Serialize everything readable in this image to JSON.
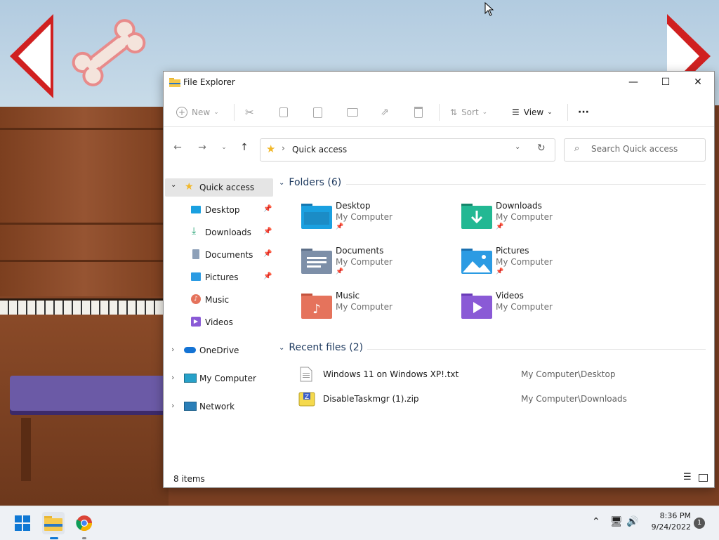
{
  "window": {
    "title": "File Explorer",
    "controls": {
      "minimize": "—",
      "maximize": "☐",
      "close": "✕"
    }
  },
  "toolbar": {
    "new_label": "New",
    "sort_label": "Sort",
    "view_label": "View",
    "more_label": "···"
  },
  "address": {
    "location": "Quick access",
    "separator": "›"
  },
  "search": {
    "placeholder": "Search Quick access"
  },
  "sidebar": {
    "quick_access": "Quick access",
    "items": [
      {
        "label": "Desktop",
        "pinned": true
      },
      {
        "label": "Downloads",
        "pinned": true
      },
      {
        "label": "Documents",
        "pinned": true
      },
      {
        "label": "Pictures",
        "pinned": true
      },
      {
        "label": "Music",
        "pinned": false
      },
      {
        "label": "Videos",
        "pinned": false
      }
    ],
    "onedrive": "OneDrive",
    "my_computer": "My Computer",
    "network": "Network"
  },
  "folders": {
    "heading": "Folders (6)",
    "items": [
      {
        "name": "Desktop",
        "location": "My Computer",
        "pinned": true,
        "color": "#1aa0e0"
      },
      {
        "name": "Downloads",
        "location": "My Computer",
        "pinned": true,
        "color": "#22b893"
      },
      {
        "name": "Documents",
        "location": "My Computer",
        "pinned": true,
        "color": "#7d8fa8"
      },
      {
        "name": "Pictures",
        "location": "My Computer",
        "pinned": true,
        "color": "#2b9be3"
      },
      {
        "name": "Music",
        "location": "My Computer",
        "pinned": false,
        "color": "#e5735c"
      },
      {
        "name": "Videos",
        "location": "My Computer",
        "pinned": false,
        "color": "#8a5ad6"
      }
    ]
  },
  "recent": {
    "heading": "Recent files (2)",
    "items": [
      {
        "name": "Windows 11 on Windows XP!.txt",
        "location": "My Computer\\Desktop",
        "icon": "text-file-icon"
      },
      {
        "name": "DisableTaskmgr (1).zip",
        "location": "My Computer\\Downloads",
        "icon": "zip-file-icon"
      }
    ]
  },
  "status": {
    "items_count": "8 items"
  },
  "taskbar": {
    "time": "8:36 PM",
    "date": "9/24/2022",
    "notifications": "1"
  }
}
